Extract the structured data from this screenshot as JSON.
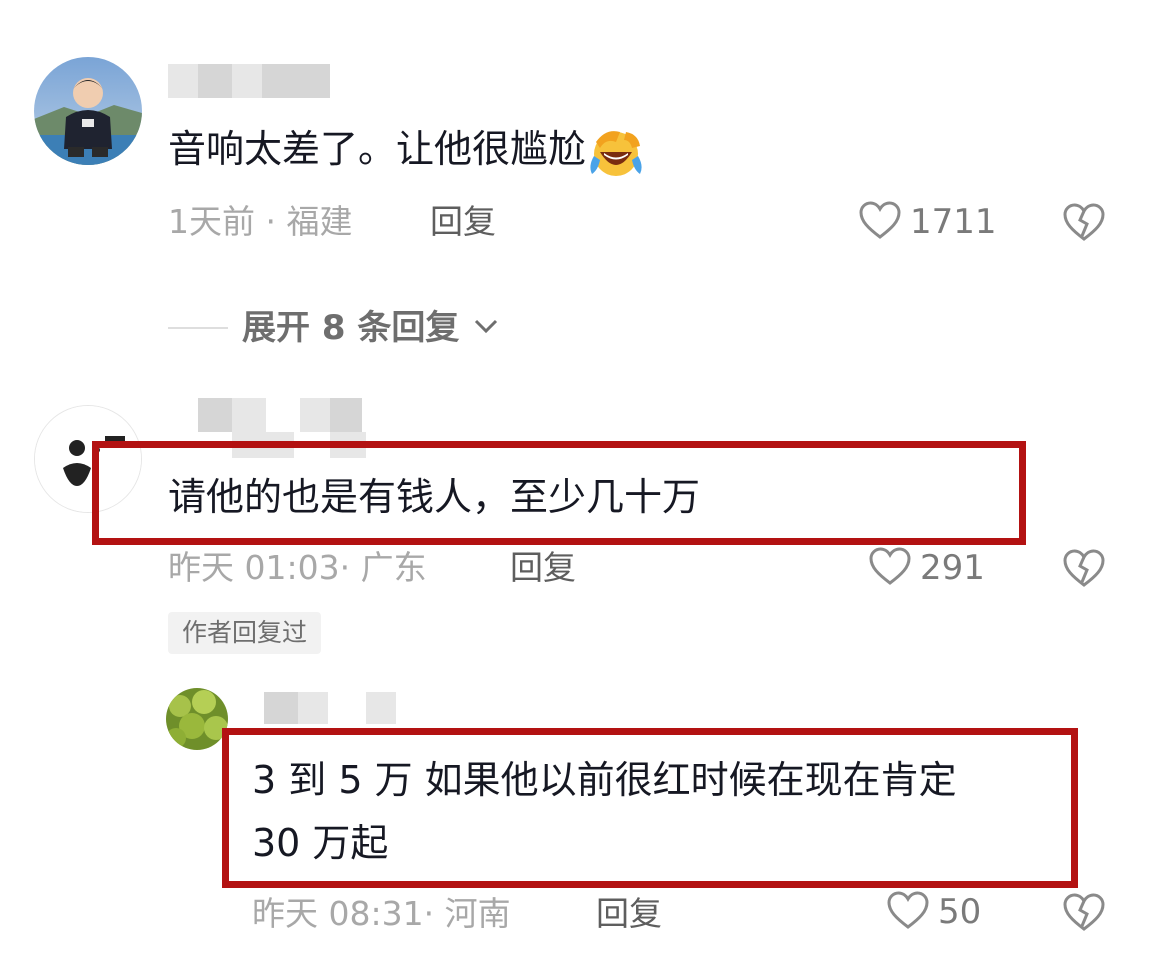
{
  "comments": [
    {
      "text": "音响太差了。让他很尴尬",
      "emoji": "laughing-crying-emoji",
      "time_location": "1天前 · 福建",
      "reply_label": "回复",
      "likes": "1711",
      "expand_label": "展开 8 条回复"
    },
    {
      "text": "请他的也是有钱人，至少几十万",
      "time_location": "昨天 01:03· 广东",
      "reply_label": "回复",
      "likes": "291",
      "badge": "作者回复过"
    },
    {
      "text_line1": "3 到 5 万  如果他以前很红时候在现在肯定",
      "text_line2": "30 万起",
      "time_location": "昨天 08:31· 河南",
      "reply_label": "回复",
      "likes": "50"
    }
  ],
  "colors": {
    "highlight_border": "#b31212",
    "meta_text": "#a8a8a8",
    "main_text": "#161823"
  },
  "icons": [
    "heart-outline-icon",
    "broken-heart-icon",
    "chevron-down-icon"
  ]
}
